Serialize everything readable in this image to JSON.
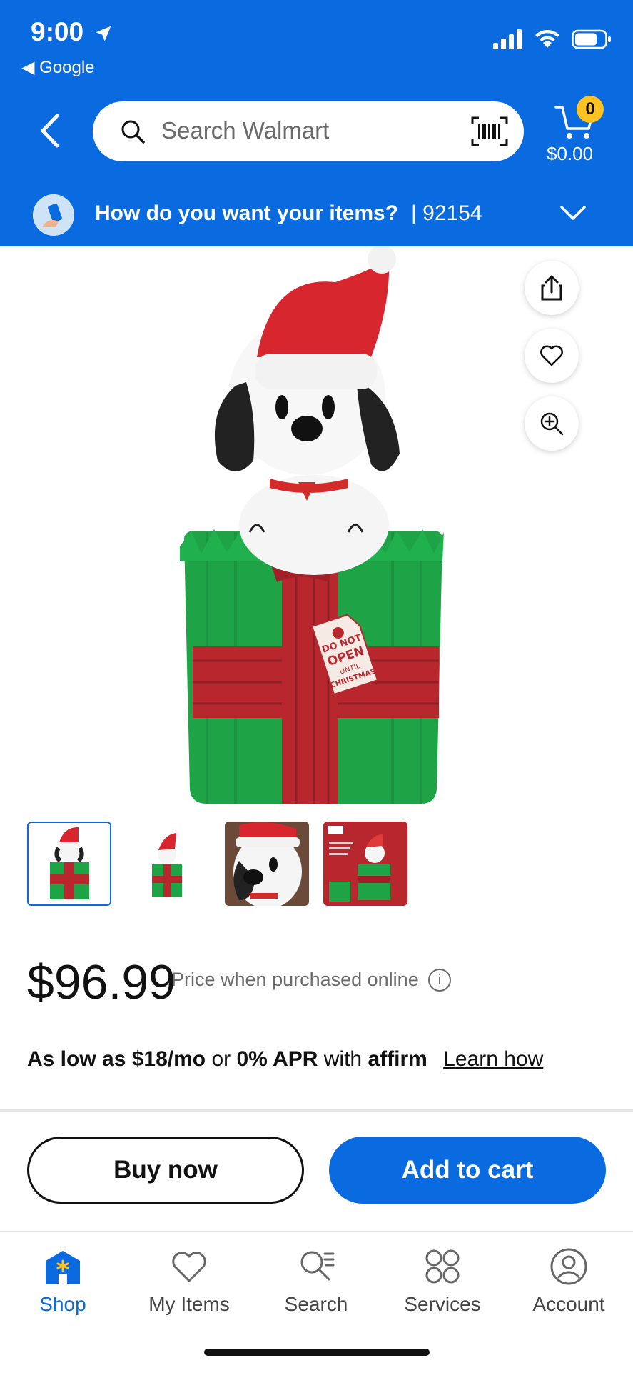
{
  "status_bar": {
    "time": "9:00",
    "back_app": "◀ Google"
  },
  "search": {
    "placeholder": "Search Walmart"
  },
  "cart": {
    "count": "0",
    "total": "$0.00"
  },
  "delivery": {
    "question": "How do you want your items?",
    "zip": "| 92154"
  },
  "product": {
    "price": "$96.99",
    "price_note": "Price when purchased online",
    "affirm": {
      "prefix": "As low as",
      "monthly": "$18/mo",
      "or": "or",
      "apr": "0% APR",
      "with": "with",
      "brand": "affirm",
      "link": "Learn how"
    }
  },
  "gift_tag": {
    "line1": "DO NOT",
    "line2": "OPEN",
    "line3": "UNTIL",
    "line4": "CHRISTMAS"
  },
  "buttons": {
    "buy_now": "Buy now",
    "add_to_cart": "Add to cart"
  },
  "tabs": [
    {
      "label": "Shop",
      "icon": "shop-icon",
      "active": true
    },
    {
      "label": "My Items",
      "icon": "heart-icon",
      "active": false
    },
    {
      "label": "Search",
      "icon": "search-list-icon",
      "active": false
    },
    {
      "label": "Services",
      "icon": "services-grid-icon",
      "active": false
    },
    {
      "label": "Account",
      "icon": "account-icon",
      "active": false
    }
  ],
  "colors": {
    "brand_blue": "#0a6be0",
    "cart_badge": "#ffc220"
  }
}
